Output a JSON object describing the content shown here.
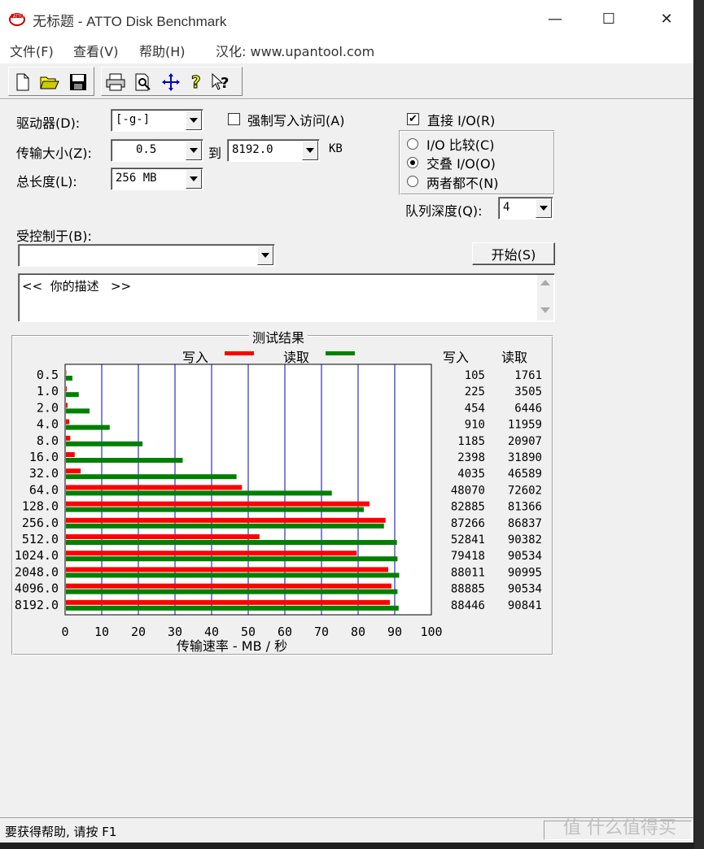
{
  "window": {
    "title": "无标题 - ATTO Disk Benchmark",
    "minimize_glyph": "—",
    "maximize_glyph": "☐",
    "close_glyph": "✕"
  },
  "menu": {
    "file": "文件(F)",
    "view": "查看(V)",
    "help": "帮助(H)",
    "hanhua": "汉化: www.upantool.com"
  },
  "toolbar": {
    "icons": [
      "new-file-icon",
      "open-folder-icon",
      "save-icon",
      "print-icon",
      "print-preview-icon",
      "move-icon",
      "help-icon",
      "context-help-icon"
    ]
  },
  "settings": {
    "drive_label": "驱动器(D):",
    "drive_value": "[-g-]",
    "force_write_label": "强制写入访问(A)",
    "force_write_checked": false,
    "direct_io_label": "直接 I/O(R)",
    "direct_io_checked": true,
    "transfer_label": "传输大小(Z):",
    "transfer_from": "0.5",
    "to_label": "到",
    "transfer_to": "8192.0",
    "kb_label": "KB",
    "total_label": "总长度(L):",
    "total_value": "256 MB",
    "io_compare": "I/O 比较(C)",
    "io_overlap": "交叠 I/O(O)",
    "io_neither": "两者都不(N)",
    "io_selected": "overlap",
    "queue_label": "队列深度(Q):",
    "queue_value": "4",
    "controlled_label": "受控制于(B):",
    "controlled_value": "",
    "start_button": "开始(S)",
    "description": "<<  你的描述   >>"
  },
  "results": {
    "group_title": "测试结果",
    "legend_write": "写入",
    "legend_read": "读取",
    "col_write": "写入",
    "col_read": "读取",
    "xlabel": "传输速率 - MB / 秒"
  },
  "colors": {
    "write": "#ff0000",
    "read": "#008000",
    "grid": "#0000c0"
  },
  "chart_data": {
    "type": "bar",
    "orientation": "horizontal",
    "categories": [
      "0.5",
      "1.0",
      "2.0",
      "4.0",
      "8.0",
      "16.0",
      "32.0",
      "64.0",
      "128.0",
      "256.0",
      "512.0",
      "1024.0",
      "2048.0",
      "4096.0",
      "8192.0"
    ],
    "series": [
      {
        "name": "写入",
        "values": [
          105,
          225,
          454,
          910,
          1185,
          2398,
          4035,
          48070,
          82885,
          87266,
          52841,
          79418,
          88011,
          88885,
          88446
        ]
      },
      {
        "name": "读取",
        "values": [
          1761,
          3505,
          6446,
          11959,
          20907,
          31890,
          46589,
          72602,
          81366,
          86837,
          90382,
          90534,
          90995,
          90534,
          90841
        ]
      }
    ],
    "xlim": [
      0,
      100
    ],
    "xticks": [
      "0",
      "10",
      "20",
      "30",
      "40",
      "50",
      "60",
      "70",
      "80",
      "90",
      "100"
    ],
    "xlabel": "传输速率 - MB / 秒",
    "grid": true,
    "legend": "top"
  },
  "status": {
    "text": "要获得帮助, 请按 F1"
  },
  "watermark": "值 什么值得买"
}
